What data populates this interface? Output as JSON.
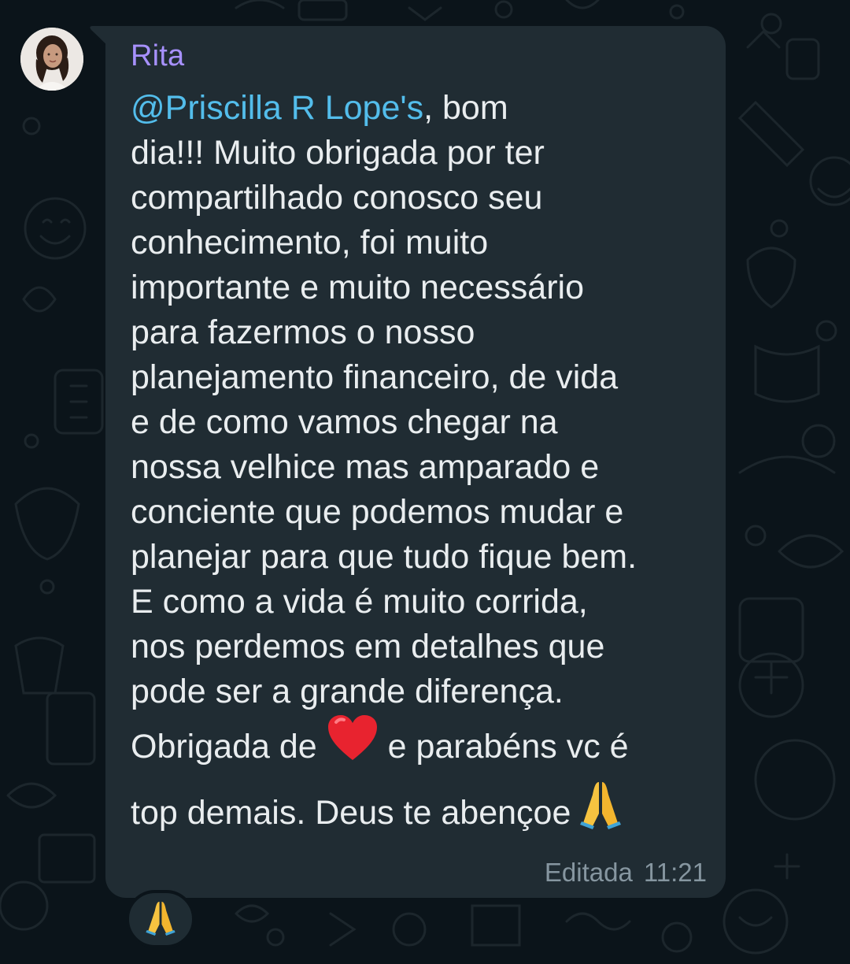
{
  "message": {
    "sender": "Rita",
    "mention": "@Priscilla R Lope's",
    "lines": [
      ", bom",
      "dia!!! Muito obrigada por ter",
      "compartilhado conosco seu",
      "conhecimento, foi muito",
      "importante e muito necessário",
      "para fazermos o nosso",
      "planejamento financeiro, de vida",
      "e de como vamos chegar na",
      "nossa velhice mas amparado e",
      "conciente que podemos mudar e",
      "planejar para que tudo fique bem.",
      "E como a vida é muito corrida,",
      "nos perdemos em detalhes que",
      "pode ser a grande diferença."
    ],
    "line_heart_before": "Obrigada de",
    "line_heart_after": "e parabéns vc é",
    "line_last": "top demais. Deus te abençoe",
    "edited_label": "Editada",
    "time": "11:21"
  },
  "icons": {
    "heart": "red-heart-emoji",
    "pray": "folded-hands-emoji",
    "avatar": "user-avatar-photo"
  },
  "reaction": {
    "emoji_name": "folded-hands-emoji"
  },
  "colors": {
    "background": "#0b141a",
    "bubble": "#202c33",
    "sender": "#a791ff",
    "mention": "#53bdeb",
    "text": "#e9edef",
    "meta": "#8696a0"
  }
}
